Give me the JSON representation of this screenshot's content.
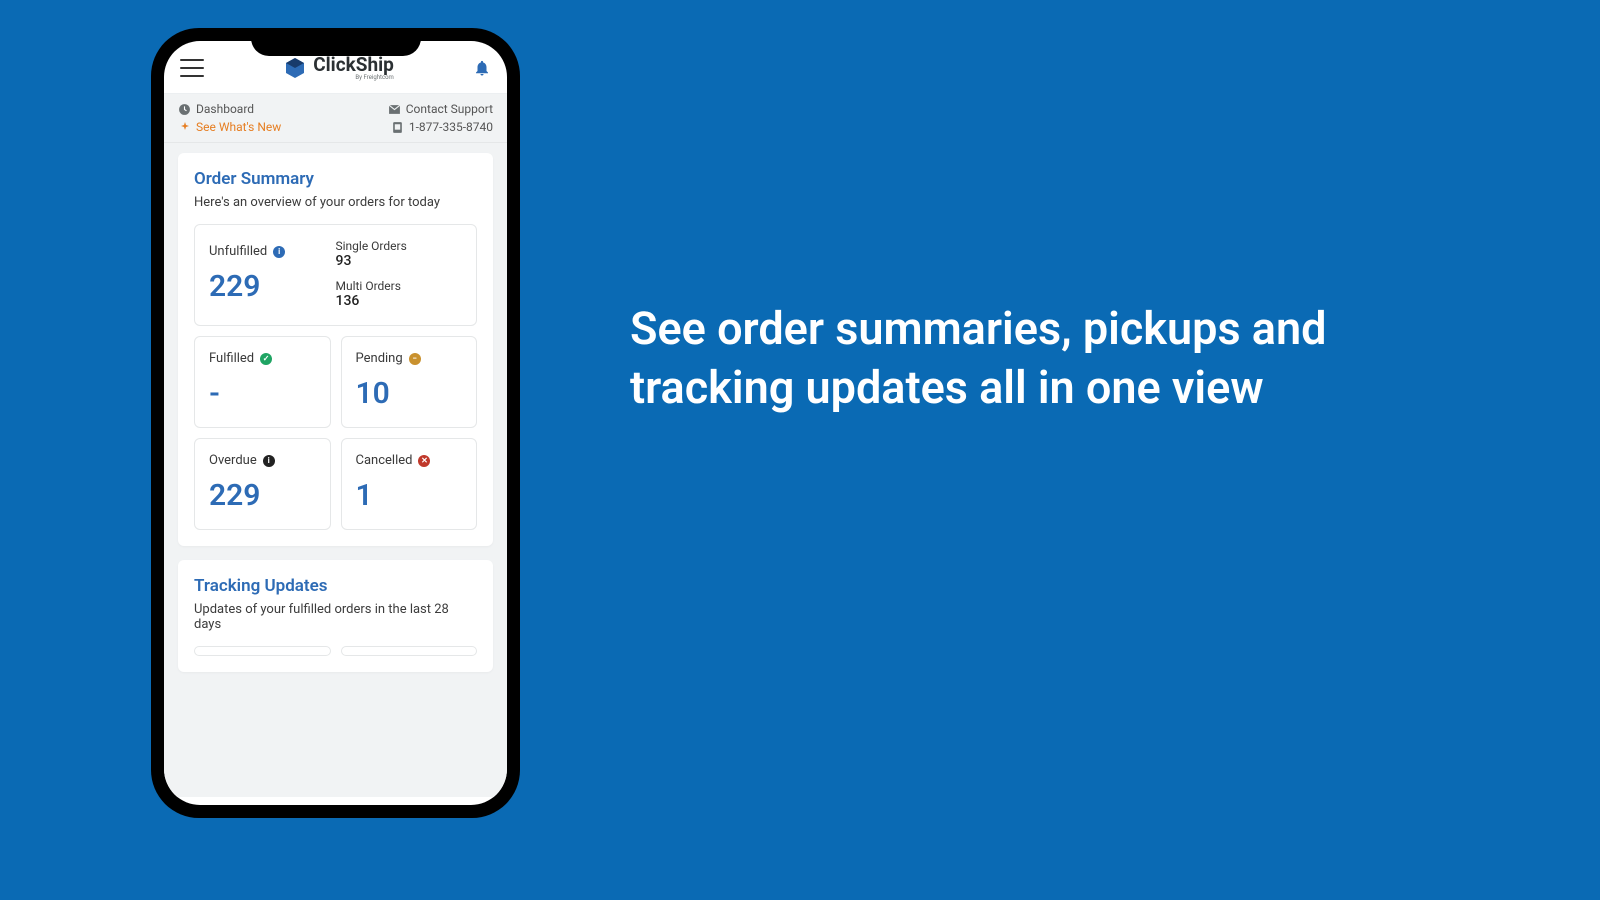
{
  "marketing": {
    "headline": "See order summaries, pickups and tracking updates all in one view"
  },
  "app": {
    "brand": "ClickShip",
    "brand_sub": "By Freightcom"
  },
  "subheader": {
    "dashboard": "Dashboard",
    "whats_new": "See What's New",
    "contact": "Contact Support",
    "phone": "1-877-335-8740"
  },
  "order_summary": {
    "title": "Order Summary",
    "desc": "Here's an overview of your orders for today",
    "unfulfilled": {
      "label": "Unfulfilled",
      "value": "229"
    },
    "single": {
      "label": "Single Orders",
      "value": "93"
    },
    "multi": {
      "label": "Multi Orders",
      "value": "136"
    },
    "fulfilled": {
      "label": "Fulfilled",
      "value": "-"
    },
    "pending": {
      "label": "Pending",
      "value": "10"
    },
    "overdue": {
      "label": "Overdue",
      "value": "229"
    },
    "cancelled": {
      "label": "Cancelled",
      "value": "1"
    }
  },
  "tracking": {
    "title": "Tracking Updates",
    "desc": "Updates of your fulfilled orders in the last 28 days"
  }
}
